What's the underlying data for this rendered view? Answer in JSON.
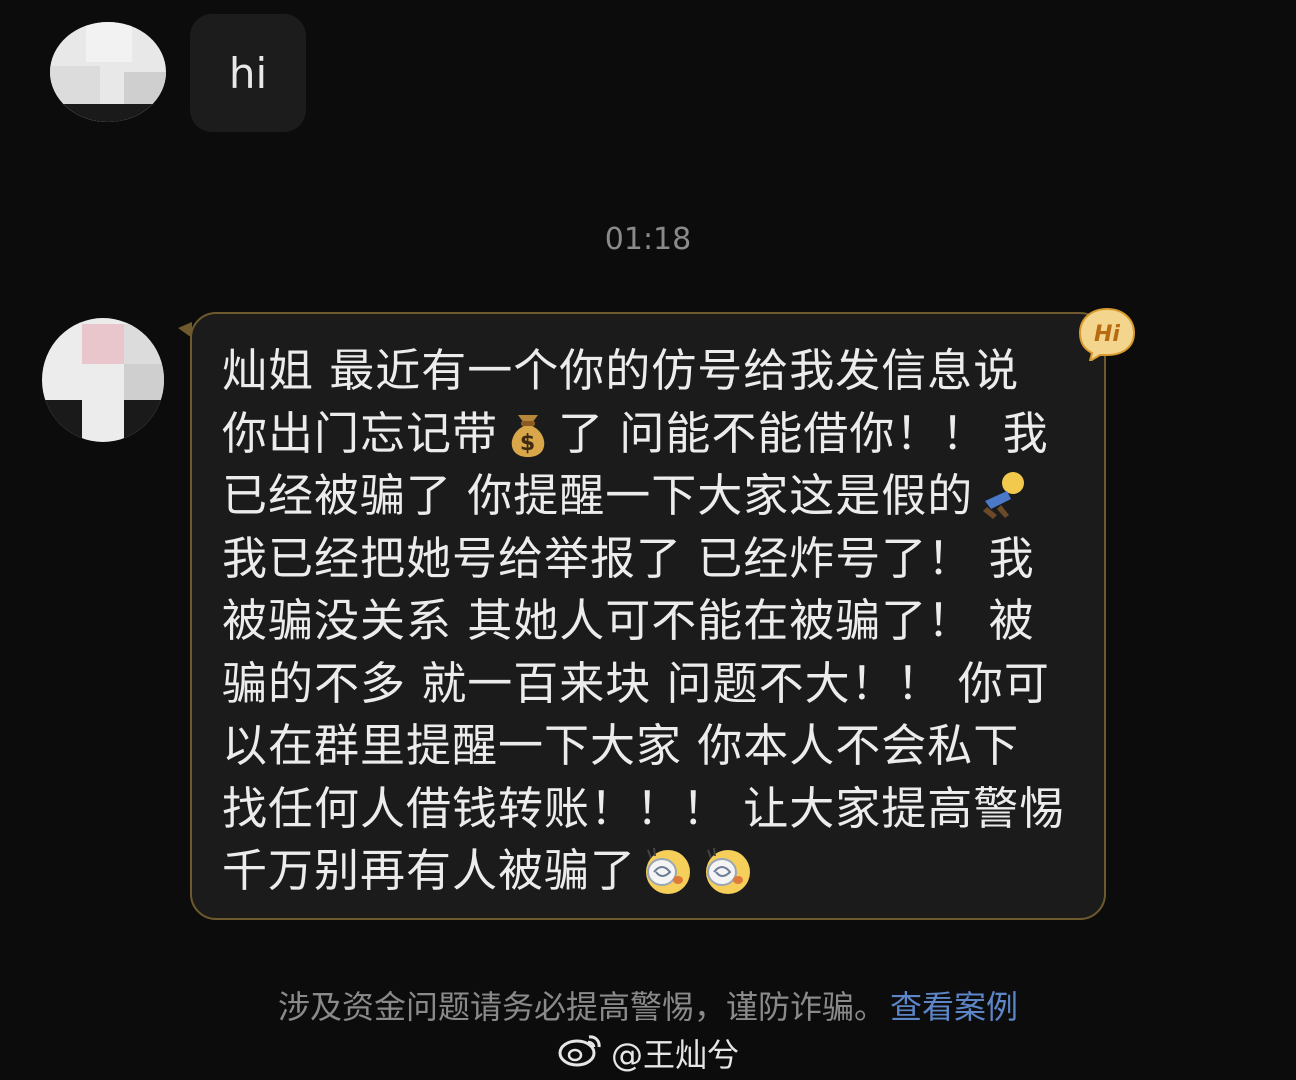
{
  "messages": [
    {
      "sender": "other",
      "text": "hi"
    },
    {
      "sender": "other",
      "lines": [
        [
          "灿姐 最近有一个你的仿号给我发信息说"
        ],
        [
          "你出门忘记带",
          "[money-bag]",
          "了 问能不能借你！！ 我"
        ],
        [
          "已经被骗了 你提醒一下大家这是假的",
          "[fainting-person]"
        ],
        [
          "我已经把她号给举报了 已经炸号了！ 我"
        ],
        [
          "被骗没关系 其她人可不能在被骗了！ 被"
        ],
        [
          "骗的不多 就一百来块 问题不大！！ 你可"
        ],
        [
          "以在群里提醒一下大家 你本人不会私下"
        ],
        [
          "找任何人借钱转账！！！ 让大家提高警惕"
        ],
        [
          "千万别再有人被骗了",
          "[dizzy-face]",
          "[dizzy-face]"
        ]
      ]
    }
  ],
  "timestamp": "01:18",
  "badge": {
    "label": "Hi",
    "color": "#e8a33a"
  },
  "notice": {
    "text": "涉及资金问题请务必提高警惕，谨防诈骗。",
    "link": "查看案例",
    "link_color": "#5d86c9"
  },
  "watermark": {
    "text": "@王灿兮",
    "icon": "weibo-logo-icon"
  },
  "colors": {
    "background": "#0c0c0c",
    "bubble": "#1b1b1b",
    "bubble_border": "#6e5a2c"
  }
}
